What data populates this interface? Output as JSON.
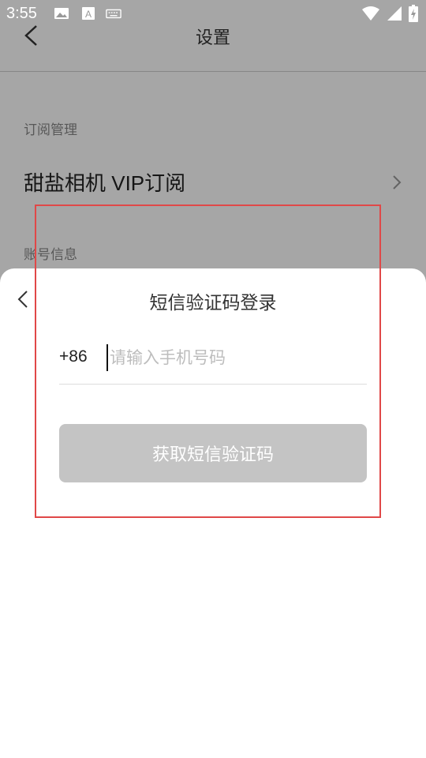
{
  "status_bar": {
    "time": "3:55",
    "icons": [
      "image-icon",
      "text-a-icon",
      "keyboard-icon"
    ],
    "right_icons": [
      "wifi-icon",
      "signal-icon",
      "battery-charging-icon"
    ]
  },
  "header": {
    "title": "设置",
    "back_icon": "chevron-left-icon"
  },
  "settings": {
    "section_subscription": "订阅管理",
    "subscription_item": "甜盐相机 VIP订阅",
    "section_account": "账号信息"
  },
  "login_sheet": {
    "title": "短信验证码登录",
    "country_code": "+86",
    "phone_placeholder": "请输入手机号码",
    "phone_value": "",
    "submit_label": "获取短信验证码"
  },
  "colors": {
    "button_disabled": "#c4c4c4",
    "highlight": "#e04848",
    "overlay": "rgba(0,0,0,0.35)"
  }
}
